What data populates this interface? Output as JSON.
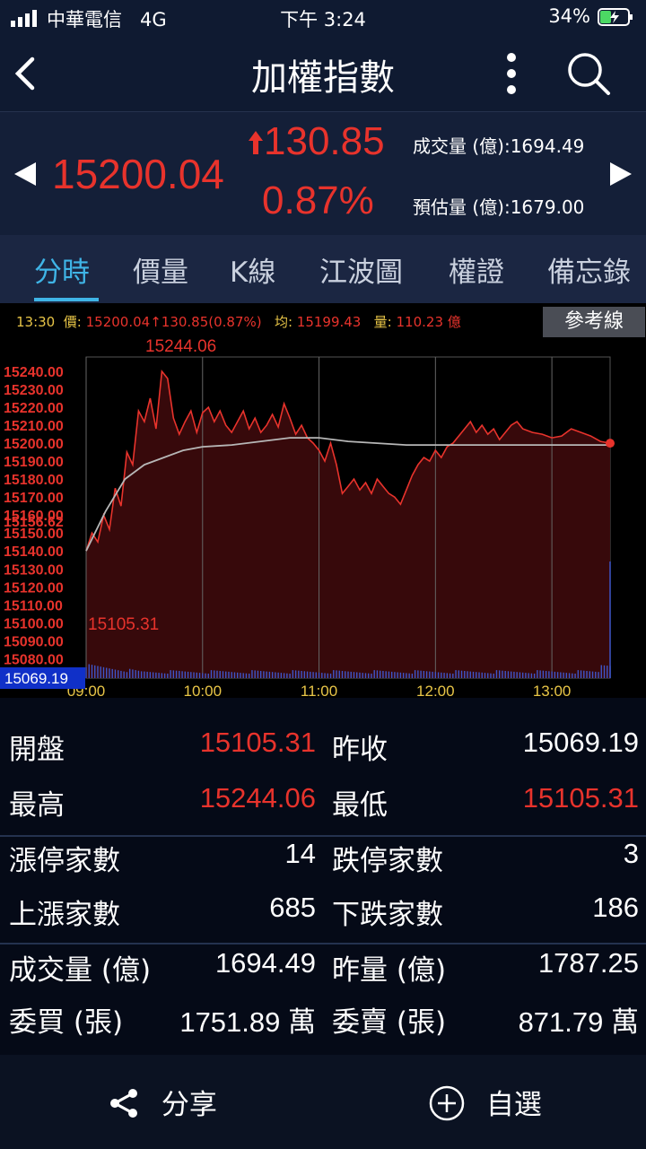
{
  "status": {
    "carrier": "中華電信",
    "network": "4G",
    "time": "下午 3:24",
    "battery": "34%"
  },
  "nav": {
    "title": "加權指數"
  },
  "quote": {
    "price": "15200.04",
    "change": "130.85",
    "percent": "0.87%",
    "volume_label": "成交量 (億):1694.49",
    "estimate_label": "預估量 (億):1679.00"
  },
  "tabs": [
    "分時",
    "價量",
    "K線",
    "江波圖",
    "權證",
    "備忘錄"
  ],
  "chart": {
    "info": {
      "time": "13:30",
      "price_label": "價:",
      "price": "15200.04",
      "change": "130.85(0.87%)",
      "avg_label": "均:",
      "avg": "15199.43",
      "vol_label": "量:",
      "vol": "110.23 億"
    },
    "ref_button": "參考線",
    "high_label": "15244.06",
    "low_label": "15105.31",
    "prev_close_label": "15069.19",
    "extra_tick": "15156.62",
    "colors": {
      "price": "#e8332c",
      "avg": "#b7b7b7",
      "volume": "#3e55c8",
      "fill": "#3a0a0c"
    }
  },
  "chart_data": {
    "type": "line",
    "x_ticks": [
      "09:00",
      "10:00",
      "11:00",
      "12:00",
      "13:00"
    ],
    "y_ticks": [
      15240,
      15230,
      15220,
      15210,
      15200,
      15190,
      15180,
      15170,
      15160,
      15150,
      15140,
      15130,
      15120,
      15110,
      15100,
      15090,
      15080
    ],
    "ylim": [
      15069.19,
      15248
    ],
    "series": [
      {
        "values_t": [
          0,
          3,
          6,
          9,
          12,
          15,
          18,
          21,
          24,
          27,
          30,
          33,
          36,
          39,
          42,
          45,
          48,
          51,
          54,
          57,
          60,
          63,
          66,
          69,
          72,
          75,
          78,
          81,
          84,
          87,
          90,
          93,
          96,
          99,
          102,
          105,
          108,
          111,
          114,
          117,
          120,
          123,
          126,
          129,
          132,
          135,
          138,
          141,
          144,
          147,
          150,
          153,
          156,
          159,
          162,
          165,
          168,
          171,
          174,
          177,
          180,
          183,
          186,
          189,
          192,
          195,
          198,
          201,
          204,
          207,
          210,
          213,
          216,
          219,
          222,
          225,
          230,
          235,
          240,
          245,
          250,
          255,
          260,
          265,
          270
        ],
        "values": [
          15140,
          15150,
          15145,
          15160,
          15152,
          15175,
          15165,
          15195,
          15188,
          15218,
          15212,
          15225,
          15208,
          15240,
          15236,
          15214,
          15205,
          15212,
          15218,
          15206,
          15217,
          15220,
          15212,
          15218,
          15210,
          15206,
          15212,
          15218,
          15208,
          15214,
          15206,
          15210,
          15216,
          15209,
          15222,
          15214,
          15205,
          15210,
          15203,
          15200,
          15196,
          15190,
          15200,
          15188,
          15172,
          15176,
          15180,
          15174,
          15178,
          15172,
          15180,
          15176,
          15172,
          15170,
          15166,
          15174,
          15182,
          15188,
          15192,
          15190,
          15196,
          15192,
          15198,
          15200,
          15204,
          15208,
          15212,
          15206,
          15210,
          15205,
          15208,
          15202,
          15206,
          15210,
          15212,
          15208,
          15206,
          15205,
          15203,
          15204,
          15208,
          15206,
          15204,
          15201,
          15200
        ]
      },
      {
        "values_t": [
          0,
          10,
          20,
          30,
          40,
          50,
          60,
          75,
          90,
          105,
          120,
          135,
          150,
          165,
          180,
          195,
          210,
          225,
          240,
          255,
          270
        ],
        "values": [
          15140,
          15162,
          15180,
          15188,
          15192,
          15196,
          15198,
          15199,
          15201,
          15203,
          15203,
          15201,
          15200,
          15199,
          15199,
          15199,
          15199,
          15199,
          15199,
          15199,
          15199
        ]
      }
    ]
  },
  "stats": {
    "open_label": "開盤",
    "open": "15105.31",
    "prev_label": "昨收",
    "prev": "15069.19",
    "high_label": "最高",
    "high": "15244.06",
    "low_label": "最低",
    "low": "15105.31",
    "limit_up_label": "漲停家數",
    "limit_up": "14",
    "limit_down_label": "跌停家數",
    "limit_down": "3",
    "up_label": "上漲家數",
    "up": "685",
    "down_label": "下跌家數",
    "down": "186",
    "vol_label": "成交量 (億)",
    "vol": "1694.49",
    "yvol_label": "昨量 (億)",
    "yvol": "1787.25",
    "bid_label": "委買 (張)",
    "bid": "1751.89 萬",
    "ask_label": "委賣 (張)",
    "ask": "871.79 萬"
  },
  "bottom": {
    "share": "分享",
    "watch": "自選"
  }
}
